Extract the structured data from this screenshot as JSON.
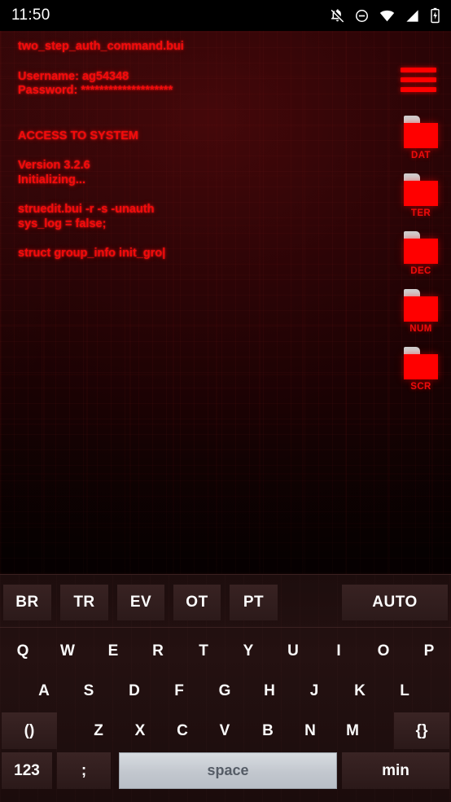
{
  "statusbar": {
    "time": "11:50",
    "icons": [
      {
        "name": "notifications-off-icon"
      },
      {
        "name": "do-not-disturb-icon"
      },
      {
        "name": "wifi-icon"
      },
      {
        "name": "cellular-signal-icon"
      },
      {
        "name": "battery-charging-icon"
      }
    ]
  },
  "terminal": {
    "accent_color": "#f30b0b",
    "lines": [
      "two_step_auth_command.bui",
      "",
      "Username: ag54348",
      "Password: ********************",
      "",
      "",
      "ACCESS TO SYSTEM",
      "",
      "Version 3.2.6",
      "Initializing...",
      "",
      "struedit.bui -r -s -unauth",
      "sys_log = false;",
      "",
      "struct group_info init_gro|"
    ],
    "cursor": "|"
  },
  "rail": {
    "menu_icon": "hamburger-menu-icon",
    "folders": [
      {
        "label": "DAT"
      },
      {
        "label": "TER"
      },
      {
        "label": "DEC"
      },
      {
        "label": "NUM"
      },
      {
        "label": "SCR"
      }
    ]
  },
  "keyboard": {
    "function_row": [
      {
        "label": "BR"
      },
      {
        "label": "TR"
      },
      {
        "label": "EV"
      },
      {
        "label": "OT"
      },
      {
        "label": "PT"
      },
      {
        "label": "AUTO"
      }
    ],
    "row1": [
      "Q",
      "W",
      "E",
      "R",
      "T",
      "Y",
      "U",
      "I",
      "O",
      "P"
    ],
    "row2": [
      "A",
      "S",
      "D",
      "F",
      "G",
      "H",
      "J",
      "K",
      "L"
    ],
    "row3": [
      "()",
      "Z",
      "X",
      "C",
      "V",
      "B",
      "N",
      "M",
      "{}"
    ],
    "row4": [
      "123",
      ";",
      "space",
      "min"
    ]
  }
}
